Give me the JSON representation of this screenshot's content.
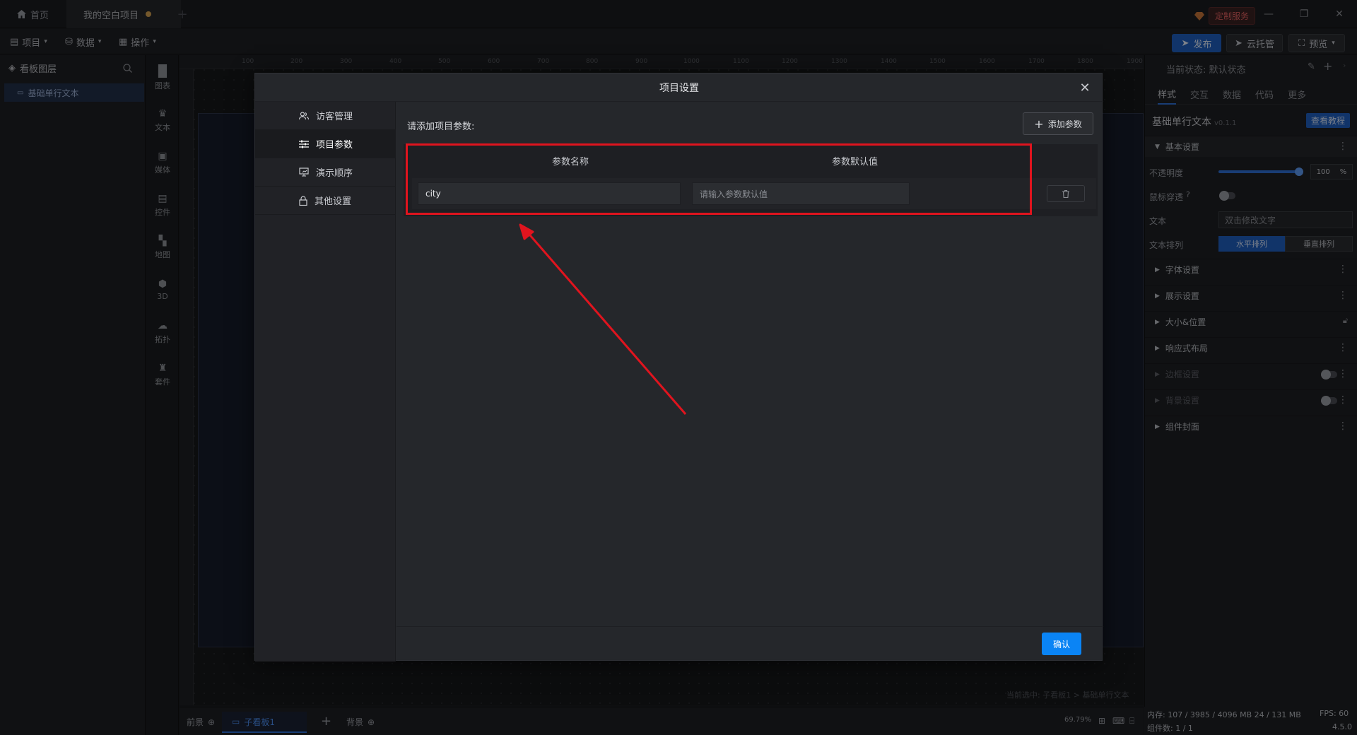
{
  "titlebar": {
    "tabs": [
      {
        "label": "首页",
        "icon": "home-icon"
      },
      {
        "label": "我的空白项目",
        "icon": "unsaved-dot"
      }
    ],
    "service_label": "定制服务"
  },
  "toolbar": {
    "menus": [
      "项目",
      "数据",
      "操作"
    ],
    "publish": "发布",
    "cloud": "云托管",
    "preview": "预览"
  },
  "layers": {
    "title": "看板图层",
    "item": "基础单行文本"
  },
  "components": [
    "图表",
    "文本",
    "媒体",
    "控件",
    "地图",
    "3D",
    "拓扑",
    "套件"
  ],
  "ruler": {
    "marks": [
      "100",
      "200",
      "300",
      "400",
      "500",
      "600",
      "700",
      "800",
      "900",
      "1000",
      "1100",
      "1200",
      "1300",
      "1400",
      "1500",
      "1600",
      "1700",
      "1800",
      "1900"
    ]
  },
  "bottombar": {
    "front": "前景",
    "subboard": "子看板1",
    "back": "背景",
    "path": "当前选中: 子看板1 > 基础单行文本",
    "zoom": "69.79%"
  },
  "rpanel": {
    "state": "当前状态:  默认状态",
    "tabs": [
      "样式",
      "交互",
      "数据",
      "代码",
      "更多"
    ],
    "component_name": "基础单行文本",
    "version": "v0.1.1",
    "tutorial": "查看教程",
    "basic": "基本设置",
    "opacity_label": "不透明度",
    "opacity_value": "100",
    "opacity_unit": "%",
    "mouse_through": "鼠标穿透",
    "text_label": "文本",
    "text_placeholder": "双击修改文字",
    "arrange_label": "文本排列",
    "arrange_h": "水平排列",
    "arrange_v": "垂直排列",
    "sections": [
      "字体设置",
      "展示设置",
      "大小&位置",
      "响应式布局",
      "边框设置",
      "背景设置",
      "组件封面"
    ]
  },
  "status": {
    "memory": "内存: 107 / 3985 / 4096 MB  24 / 131 MB",
    "fps": "FPS: 60",
    "components": "组件数: 1 / 1",
    "version": "4.5.0"
  },
  "modal": {
    "title": "项目设置",
    "nav": [
      "访客管理",
      "项目参数",
      "演示顺序",
      "其他设置"
    ],
    "hint": "请添加项目参数:",
    "add_param": "添加参数",
    "col_name": "参数名称",
    "col_default": "参数默认值",
    "param_name": "city",
    "default_placeholder": "请输入参数默认值",
    "confirm": "确认"
  },
  "colors": {
    "accent": "#0a84f5",
    "highlight": "#e0141e",
    "publish": "#1f5fbf"
  }
}
